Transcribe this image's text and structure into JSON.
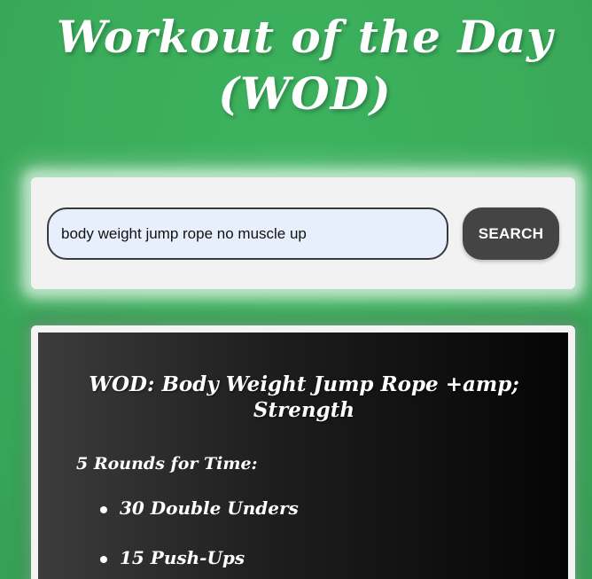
{
  "header": {
    "title": "Workout of the Day (WOD)"
  },
  "search": {
    "value": "body weight jump rope no muscle up",
    "button_label": "SEARCH"
  },
  "wod": {
    "title": "WOD: Body Weight Jump Rope +amp; Strength",
    "format": "5 Rounds for Time:",
    "items": [
      {
        "label": "30 Double Unders"
      },
      {
        "label": "15 Push-Ups"
      }
    ]
  }
}
